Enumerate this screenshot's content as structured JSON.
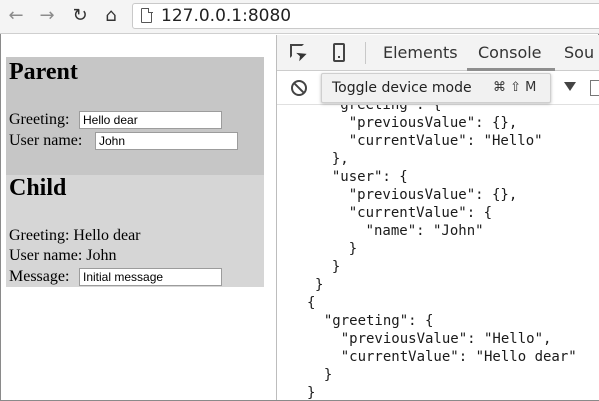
{
  "browser": {
    "back_icon": "arrow-left",
    "forward_icon": "arrow-right",
    "reload_icon": "reload",
    "home_icon": "home",
    "url": "127.0.0.1:8080"
  },
  "page": {
    "parent": {
      "heading": "Parent",
      "greeting_label": "Greeting:",
      "greeting_value": "Hello dear",
      "username_label": "User name:",
      "username_value": "John"
    },
    "child": {
      "heading": "Child",
      "greeting_text": "Greeting: Hello dear",
      "username_text": "User name: John",
      "message_label": "Message:",
      "message_value": "Initial message"
    }
  },
  "devtools": {
    "tabs": [
      "Elements",
      "Console",
      "Sou"
    ],
    "active_tab": "Console",
    "tooltip": {
      "label": "Toggle device mode",
      "shortcut": "⌘ ⇧ M"
    },
    "console_lines": [
      "  \"greeting\": {",
      "    \"previousValue\": {},",
      "    \"currentValue\": \"Hello\"",
      "  },",
      "  \"user\": {",
      "    \"previousValue\": {},",
      "    \"currentValue\": {",
      "      \"name\": \"John\"",
      "    }",
      "  }",
      "}",
      "{",
      "  \"greeting\": {",
      "    \"previousValue\": \"Hello\",",
      "    \"currentValue\": \"Hello dear\"",
      "  }",
      "}"
    ]
  },
  "colors": {
    "parent_bg": "#c6c6c6",
    "child_bg": "#d6d6d6",
    "toolbar_bg": "#f4f4f4"
  }
}
